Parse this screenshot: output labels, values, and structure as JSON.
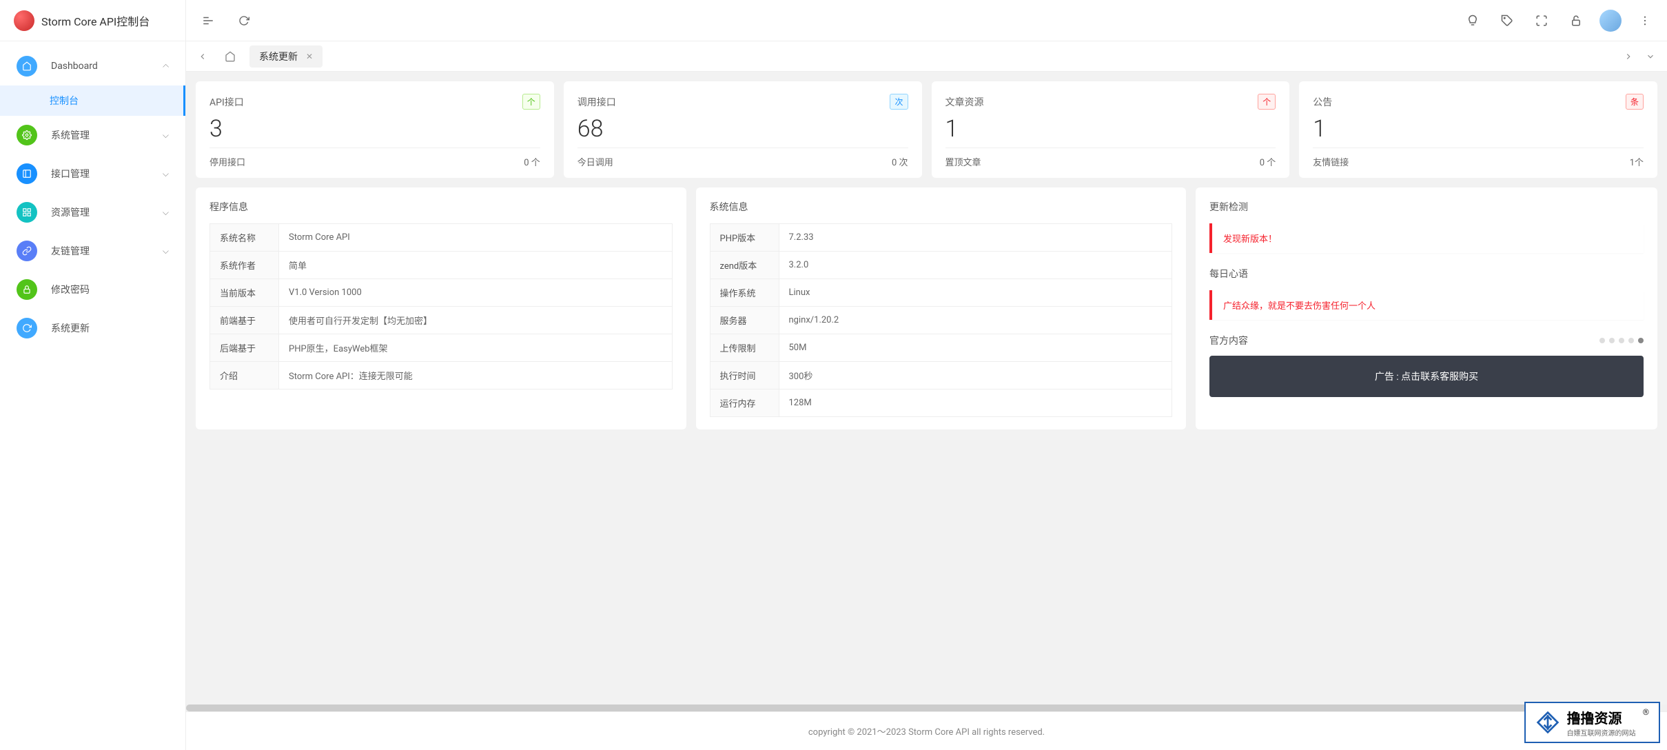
{
  "app": {
    "title": "Storm Core API控制台"
  },
  "sidebar": {
    "items": [
      {
        "label": "Dashboard",
        "icon_bg": "#40a9ff",
        "expanded": true
      },
      {
        "label": "控制台",
        "sub": true,
        "active": true
      },
      {
        "label": "系统管理",
        "icon_bg": "#52c41a",
        "expanded": false
      },
      {
        "label": "接口管理",
        "icon_bg": "#1890ff",
        "expanded": false
      },
      {
        "label": "资源管理",
        "icon_bg": "#13c2c2",
        "expanded": false
      },
      {
        "label": "友链管理",
        "icon_bg": "#597ef7",
        "expanded": false
      },
      {
        "label": "修改密码",
        "icon_bg": "#52c41a",
        "expanded": null
      },
      {
        "label": "系统更新",
        "icon_bg": "#40a9ff",
        "expanded": null
      }
    ]
  },
  "tabs": {
    "items": [
      {
        "label": "系统更新",
        "active": true,
        "closable": true
      }
    ]
  },
  "stats": [
    {
      "title": "API接口",
      "badge": "个",
      "badge_style": "green",
      "value": "3",
      "foot_label": "停用接口",
      "foot_value": "0 个"
    },
    {
      "title": "调用接口",
      "badge": "次",
      "badge_style": "blue",
      "value": "68",
      "foot_label": "今日调用",
      "foot_value": "0 次"
    },
    {
      "title": "文章资源",
      "badge": "个",
      "badge_style": "red",
      "value": "1",
      "foot_label": "置顶文章",
      "foot_value": "0 个"
    },
    {
      "title": "公告",
      "badge": "条",
      "badge_style": "red",
      "value": "1",
      "foot_label": "友情链接",
      "foot_value": "1个"
    }
  ],
  "program_info": {
    "title": "程序信息",
    "rows": [
      {
        "k": "系统名称",
        "v": "Storm Core API"
      },
      {
        "k": "系统作者",
        "v": "简单"
      },
      {
        "k": "当前版本",
        "v": "V1.0 Version 1000"
      },
      {
        "k": "前端基于",
        "v": "使用者可自行开发定制【均无加密】"
      },
      {
        "k": "后端基于",
        "v": "PHP原生，EasyWeb框架"
      },
      {
        "k": "介绍",
        "v": "Storm Core API：连接无限可能"
      }
    ]
  },
  "system_info": {
    "title": "系统信息",
    "rows": [
      {
        "k": "PHP版本",
        "v": "7.2.33"
      },
      {
        "k": "zend版本",
        "v": "3.2.0"
      },
      {
        "k": "操作系统",
        "v": "Linux"
      },
      {
        "k": "服务器",
        "v": "nginx/1.20.2"
      },
      {
        "k": "上传限制",
        "v": "50M"
      },
      {
        "k": "执行时间",
        "v": "300秒"
      },
      {
        "k": "运行内存",
        "v": "128M"
      }
    ]
  },
  "update_check": {
    "title": "更新检测",
    "message": "发现新版本！"
  },
  "daily_quote": {
    "title": "每日心语",
    "message": "广结众缘，就是不要去伤害任何一个人"
  },
  "official": {
    "title": "官方内容",
    "ad_text": "广告 : 点击联系客服购买"
  },
  "footer": {
    "copyright": "copyright © 2021～2023 Storm Core API all rights reserved."
  },
  "watermark": {
    "main": "撸撸资源",
    "sub": "白嫖互联网资源的网站",
    "reg": "®"
  }
}
